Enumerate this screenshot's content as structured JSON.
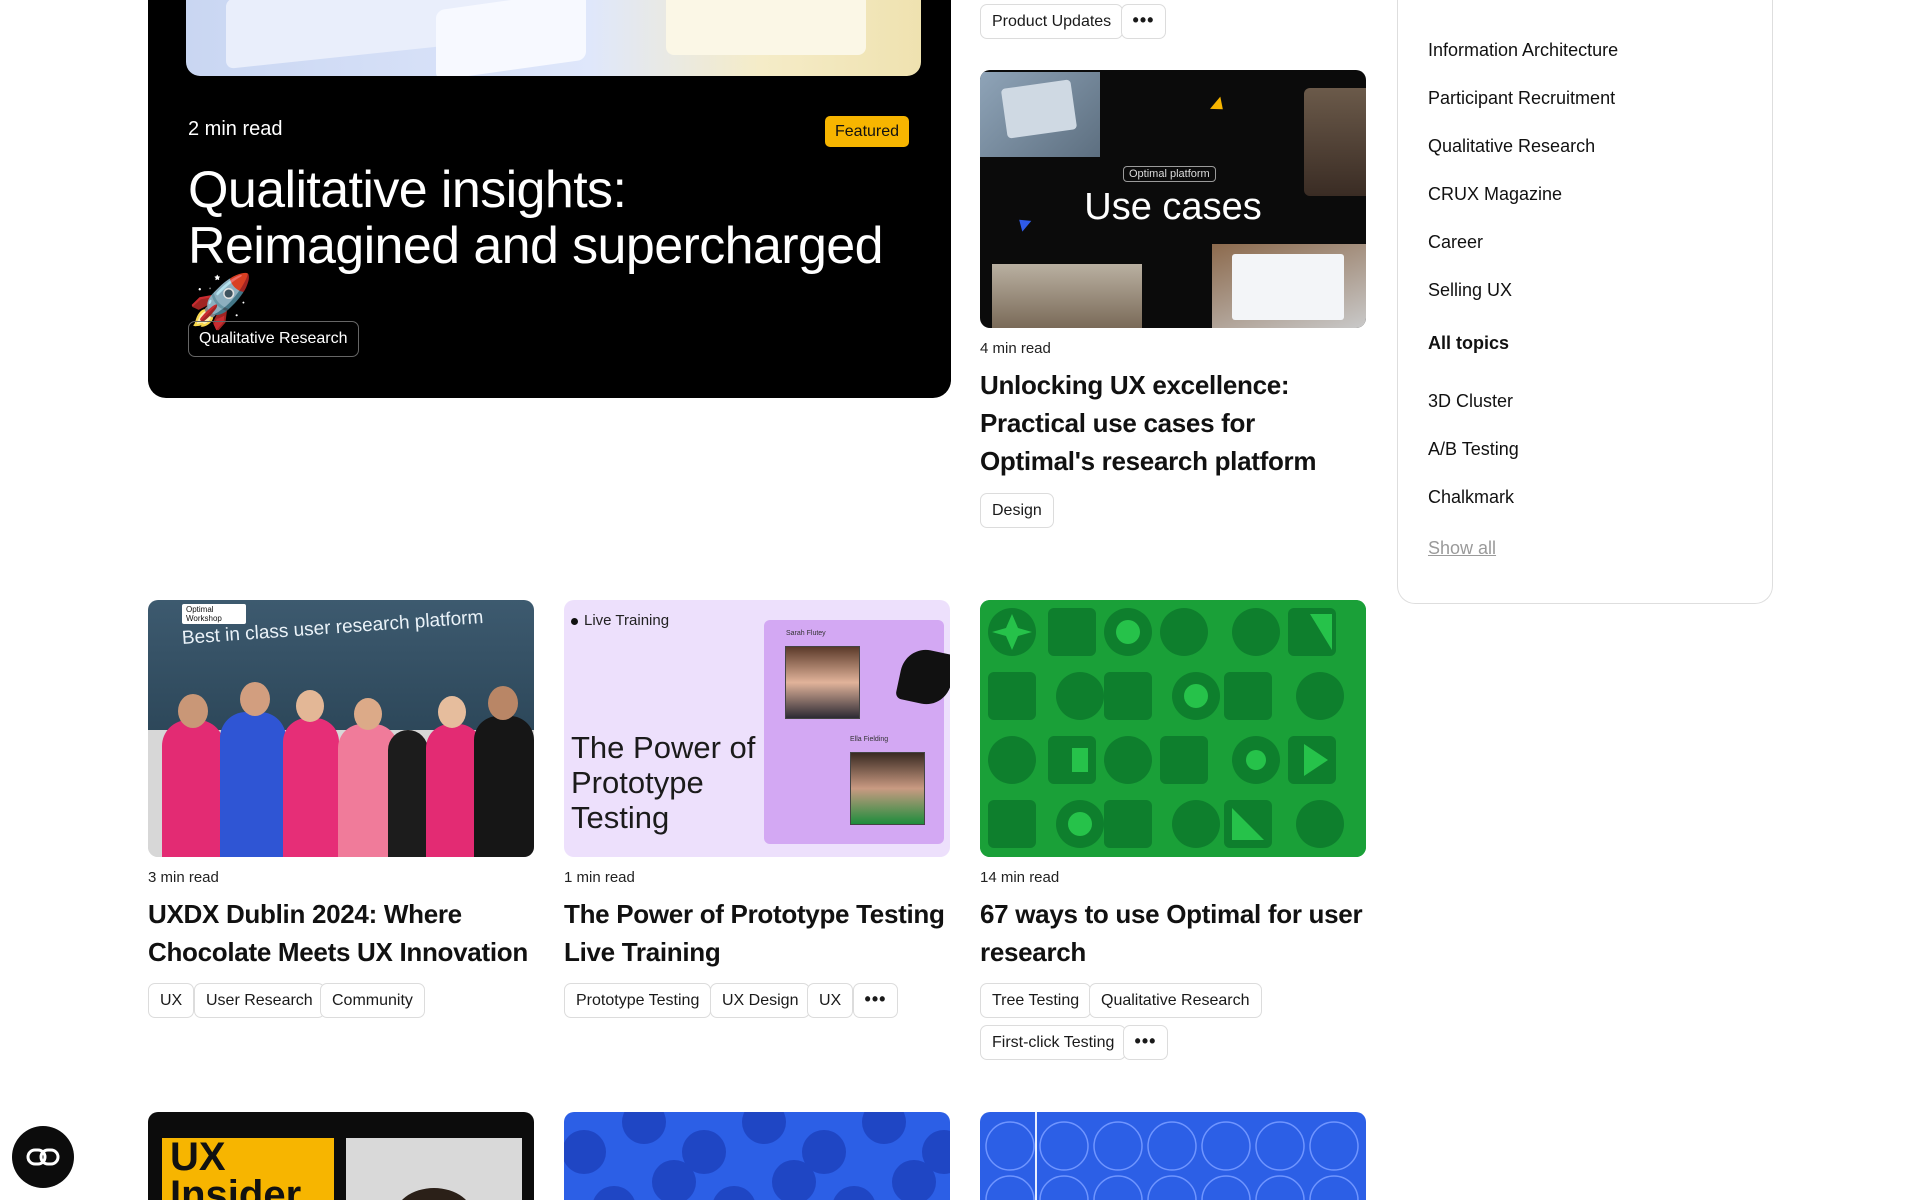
{
  "featured": {
    "read_time": "2 min read",
    "badge": "Featured",
    "title": "Qualitative insights: Reimagined and supercharged",
    "emoji": "🚀",
    "tag": "Qualitative Research"
  },
  "top_right_card": {
    "tags": [
      "Product Updates"
    ],
    "more": "•••"
  },
  "use_cases_card": {
    "image_label": "Optimal platform",
    "image_title": "Use cases",
    "read_time": "4 min read",
    "title": "Unlocking UX excellence: Practical use cases for Optimal's research platform",
    "tags": [
      "Design"
    ]
  },
  "cards": [
    {
      "image_title": "Best in class user research platform",
      "image_badge": "Optimal Workshop",
      "read_time": "3 min read",
      "title": "UXDX Dublin 2024: Where Chocolate Meets UX Innovation",
      "tags": [
        "UX",
        "User Research",
        "Community"
      ]
    },
    {
      "image_badge": "Live Training",
      "image_title": "The Power of Prototype Testing",
      "image_name_1": "Sarah Flutey",
      "image_name_2": "Ella Fielding",
      "read_time": "1 min read",
      "title": "The Power of Prototype Testing Live Training",
      "tags": [
        "Prototype Testing",
        "UX Design",
        "UX"
      ],
      "more": "•••"
    },
    {
      "read_time": "14 min read",
      "title": "67 ways to use Optimal for user research",
      "tags": [
        "Tree Testing",
        "Qualitative Research",
        "First-click Testing"
      ],
      "more": "•••"
    }
  ],
  "bottom_row": {
    "card1_text": "UX Insider"
  },
  "sidebar": {
    "items": [
      "Information Architecture",
      "Participant Recruitment",
      "Qualitative Research",
      "CRUX Magazine",
      "Career",
      "Selling UX"
    ],
    "all_topics_heading": "All topics",
    "topics": [
      "3D Cluster",
      "A/B Testing",
      "Chalkmark"
    ],
    "show_all": "Show all"
  },
  "colors": {
    "featured_bg": "#000000",
    "badge": "#f7b500",
    "green": "#1aa038",
    "blue": "#2f5be8",
    "lilac": "#e6d6fb"
  }
}
